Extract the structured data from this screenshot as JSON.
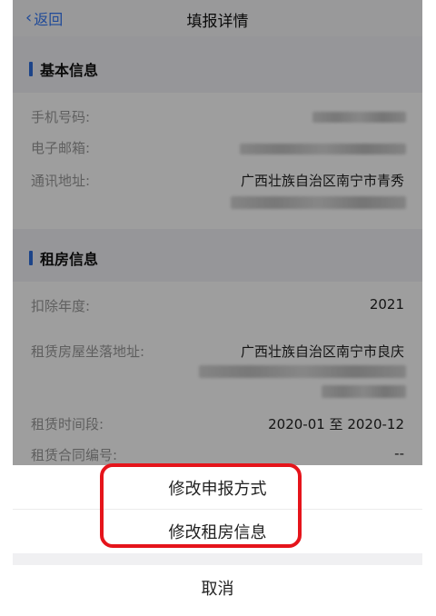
{
  "nav": {
    "back_label": "返回",
    "title": "填报详情"
  },
  "basic_info": {
    "heading": "基本信息",
    "phone_label": "手机号码:",
    "email_label": "电子邮箱:",
    "address_label": "通讯地址:",
    "address_value": "广西壮族自治区南宁市青秀"
  },
  "rental_info": {
    "heading": "租房信息",
    "year_label": "扣除年度:",
    "year_value": "2021",
    "location_label": "租赁房屋坐落地址:",
    "location_value": "广西壮族自治区南宁市良庆",
    "period_label": "租赁时间段:",
    "period_value": "2020-01 至 2020-12",
    "contract_label": "租赁合同编号:",
    "contract_value": "--"
  },
  "action_sheet": {
    "modify_method": "修改申报方式",
    "modify_rental": "修改租房信息",
    "cancel": "取消"
  },
  "colors": {
    "accent": "#3478f6",
    "highlight": "#e5141b"
  }
}
